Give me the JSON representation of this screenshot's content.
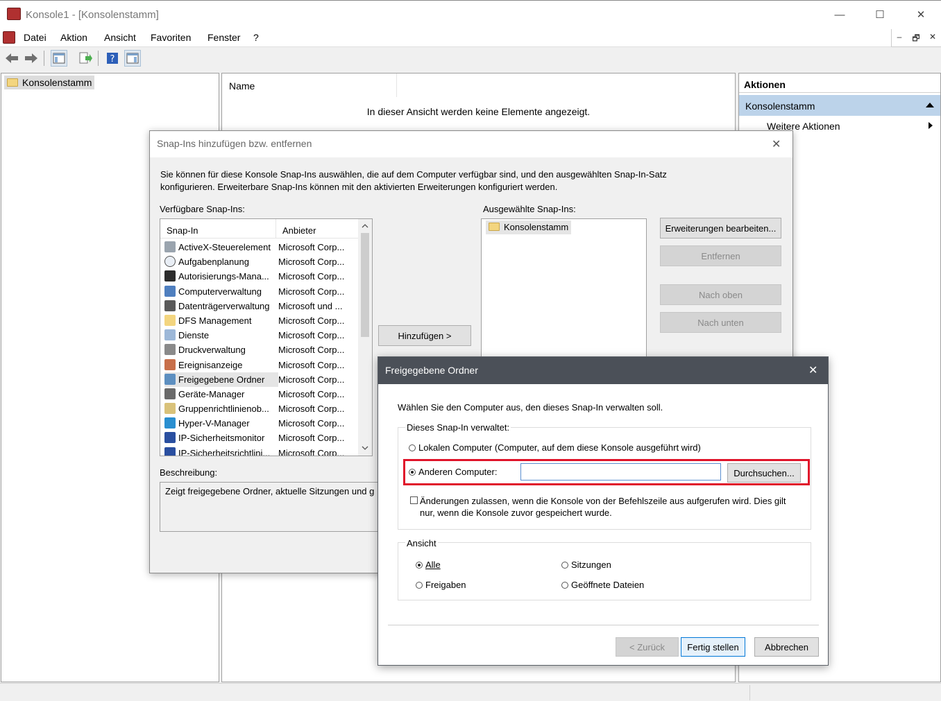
{
  "window": {
    "title": "Konsole1 - [Konsolenstamm]",
    "controls": {
      "minimize": "—",
      "maximize": "☐",
      "close": "✕"
    }
  },
  "menu": [
    "Datei",
    "Aktion",
    "Ansicht",
    "Favoriten",
    "Fenster",
    "?"
  ],
  "mdi_controls": {
    "minimize": "–",
    "restore": "🗗",
    "close": "✕"
  },
  "tree": {
    "root": "Konsolenstamm"
  },
  "center": {
    "column_name": "Name",
    "empty_text": "In dieser Ansicht werden keine Elemente angezeigt."
  },
  "actions": {
    "header": "Aktionen",
    "section": "Konsolenstamm",
    "more": "Weitere Aktionen"
  },
  "snapin_dialog": {
    "title": "Snap-Ins hinzufügen bzw. entfernen",
    "close": "✕",
    "intro_line1": "Sie können für diese Konsole Snap-Ins auswählen, die auf dem Computer verfügbar sind, und den ausgewählten Snap-In-Satz",
    "intro_line2": "konfigurieren. Erweiterbare Snap-Ins können mit den aktivierten Erweiterungen konfiguriert werden.",
    "available_label": "Verfügbare Snap-Ins:",
    "col_snapin": "Snap-In",
    "col_vendor": "Anbieter",
    "available": [
      {
        "name": "ActiveX-Steuerelement",
        "vendor": "Microsoft Corp...",
        "icon": "activex-icon"
      },
      {
        "name": "Aufgabenplanung",
        "vendor": "Microsoft Corp...",
        "icon": "clock-icon"
      },
      {
        "name": "Autorisierungs-Mana...",
        "vendor": "Microsoft Corp...",
        "icon": "authorization-icon"
      },
      {
        "name": "Computerverwaltung",
        "vendor": "Microsoft Corp...",
        "icon": "computer-management-icon"
      },
      {
        "name": "Datenträgerverwaltung",
        "vendor": "Microsoft und ...",
        "icon": "disk-icon"
      },
      {
        "name": "DFS Management",
        "vendor": "Microsoft Corp...",
        "icon": "folder-icon"
      },
      {
        "name": "Dienste",
        "vendor": "Microsoft Corp...",
        "icon": "services-gear-icon"
      },
      {
        "name": "Druckverwaltung",
        "vendor": "Microsoft Corp...",
        "icon": "printer-icon"
      },
      {
        "name": "Ereignisanzeige",
        "vendor": "Microsoft Corp...",
        "icon": "event-viewer-icon"
      },
      {
        "name": "Freigegebene Ordner",
        "vendor": "Microsoft Corp...",
        "icon": "shared-folder-icon"
      },
      {
        "name": "Geräte-Manager",
        "vendor": "Microsoft Corp...",
        "icon": "device-manager-icon"
      },
      {
        "name": "Gruppenrichtlinienob...",
        "vendor": "Microsoft Corp...",
        "icon": "group-policy-icon"
      },
      {
        "name": "Hyper-V-Manager",
        "vendor": "Microsoft Corp...",
        "icon": "hyperv-icon"
      },
      {
        "name": "IP-Sicherheitsmonitor",
        "vendor": "Microsoft Corp...",
        "icon": "ip-security-icon"
      },
      {
        "name": "IP-Sicherheitsrichtlini...",
        "vendor": "Microsoft Corp...",
        "icon": "ip-policy-icon"
      }
    ],
    "add_button": "Hinzufügen >",
    "selected_label": "Ausgewählte Snap-Ins:",
    "selected": [
      "Konsolenstamm"
    ],
    "btn_extensions": "Erweiterungen bearbeiten...",
    "btn_remove": "Entfernen",
    "btn_up": "Nach oben",
    "btn_down": "Nach unten",
    "description_label": "Beschreibung:",
    "description": "Zeigt freigegebene Ordner, aktuelle Sitzungen und g"
  },
  "shared_dialog": {
    "title": "Freigegebene Ordner",
    "close": "✕",
    "prompt": "Wählen Sie den Computer aus, den dieses Snap-In verwalten soll.",
    "manages_label": "Dieses Snap-In verwaltet:",
    "opt_local": "Lokalen Computer (Computer, auf dem diese Konsole ausgeführt wird)",
    "opt_other": "Anderen Computer:",
    "computer_value": "",
    "browse": "Durchsuchen...",
    "allow_line1": "Änderungen zulassen, wenn die Konsole von der Befehlszeile aus aufgerufen wird. Dies gilt",
    "allow_line2": "nur, wenn die Konsole zuvor gespeichert wurde.",
    "view_label": "Ansicht",
    "view_all": "Alle",
    "view_sessions": "Sitzungen",
    "view_shares": "Freigaben",
    "view_open_files": "Geöffnete Dateien",
    "btn_back": "< Zurück",
    "btn_finish": "Fertig stellen",
    "btn_cancel": "Abbrechen"
  },
  "colors": {
    "highlight_border": "#e0142a",
    "dialog_header": "#4b5058",
    "actions_section": "#bcd3ea"
  }
}
